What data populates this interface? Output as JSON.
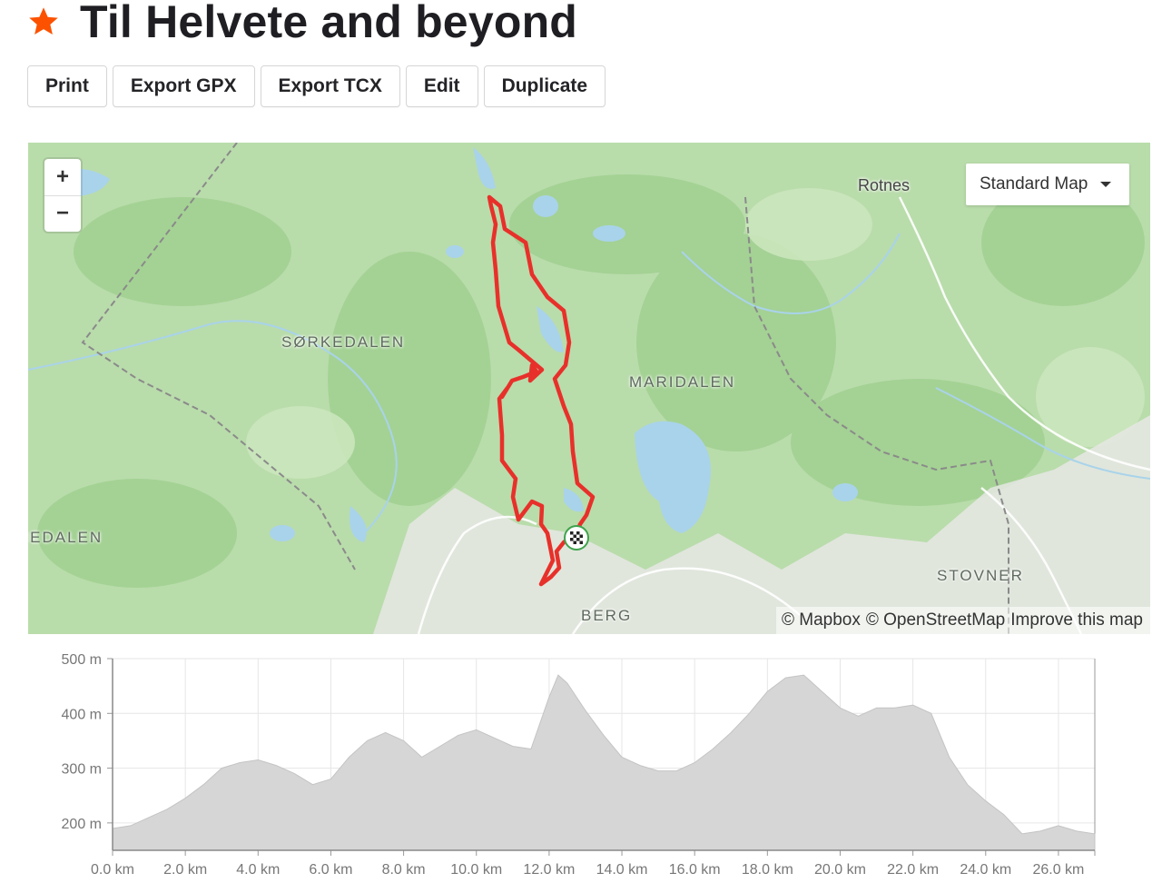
{
  "header": {
    "title": "Til Helvete and beyond",
    "favorite_icon": "star-icon",
    "accent_color": "#fc5200"
  },
  "toolbar": {
    "print_label": "Print",
    "export_gpx_label": "Export GPX",
    "export_tcx_label": "Export TCX",
    "edit_label": "Edit",
    "duplicate_label": "Duplicate"
  },
  "map": {
    "zoom_in_label": "+",
    "zoom_out_label": "−",
    "map_type_selected": "Standard Map",
    "places": {
      "rotnes": "Rotnes",
      "sorkedalen": "SØRKEDALEN",
      "maridalen": "MARIDALEN",
      "medalen": "MEDALEN",
      "stovner": "STOVNER",
      "berg": "BERG"
    },
    "attribution": {
      "mapbox": "© Mapbox",
      "osm": "© OpenStreetMap",
      "improve": "Improve this map"
    },
    "route_color": "#e8302a",
    "finish_icon": "checkered-flag-icon"
  },
  "chart_data": {
    "type": "area",
    "title": "",
    "xlabel": "",
    "ylabel": "",
    "x_unit": "km",
    "y_unit": "m",
    "xlim": [
      0,
      27
    ],
    "ylim": [
      150,
      500
    ],
    "x_ticks": [
      "0.0 km",
      "2.0 km",
      "4.0 km",
      "6.0 km",
      "8.0 km",
      "10.0 km",
      "12.0 km",
      "14.0 km",
      "16.0 km",
      "18.0 km",
      "20.0 km",
      "22.0 km",
      "24.0 km",
      "26.0 km"
    ],
    "x_tick_values": [
      0,
      2,
      4,
      6,
      8,
      10,
      12,
      14,
      16,
      18,
      20,
      22,
      24,
      26
    ],
    "y_ticks": [
      "200 m",
      "300 m",
      "400 m",
      "500 m"
    ],
    "y_tick_values": [
      200,
      300,
      400,
      500
    ],
    "grid": true,
    "fill_color": "#d6d6d6",
    "series": [
      {
        "x": [
          0,
          0.5,
          1,
          1.5,
          2,
          2.5,
          3,
          3.5,
          4,
          4.5,
          5,
          5.5,
          6,
          6.5,
          7,
          7.5,
          8,
          8.5,
          9,
          9.5,
          10,
          10.5,
          11,
          11.5,
          12,
          12.25,
          12.5,
          13,
          13.5,
          14,
          14.5,
          15,
          15.5,
          16,
          16.5,
          17,
          17.5,
          18,
          18.5,
          19,
          19.5,
          20,
          20.5,
          21,
          21.5,
          22,
          22.5,
          23,
          23.5,
          24,
          24.5,
          25,
          25.5,
          26,
          26.5,
          27
        ],
        "y": [
          190,
          195,
          210,
          225,
          245,
          270,
          300,
          310,
          315,
          305,
          290,
          270,
          280,
          320,
          350,
          365,
          350,
          320,
          340,
          360,
          370,
          355,
          340,
          335,
          430,
          470,
          455,
          405,
          360,
          320,
          305,
          295,
          295,
          310,
          335,
          365,
          400,
          440,
          465,
          470,
          440,
          410,
          395,
          410,
          410,
          415,
          400,
          320,
          270,
          240,
          215,
          180,
          185,
          195,
          185,
          180
        ]
      }
    ]
  }
}
